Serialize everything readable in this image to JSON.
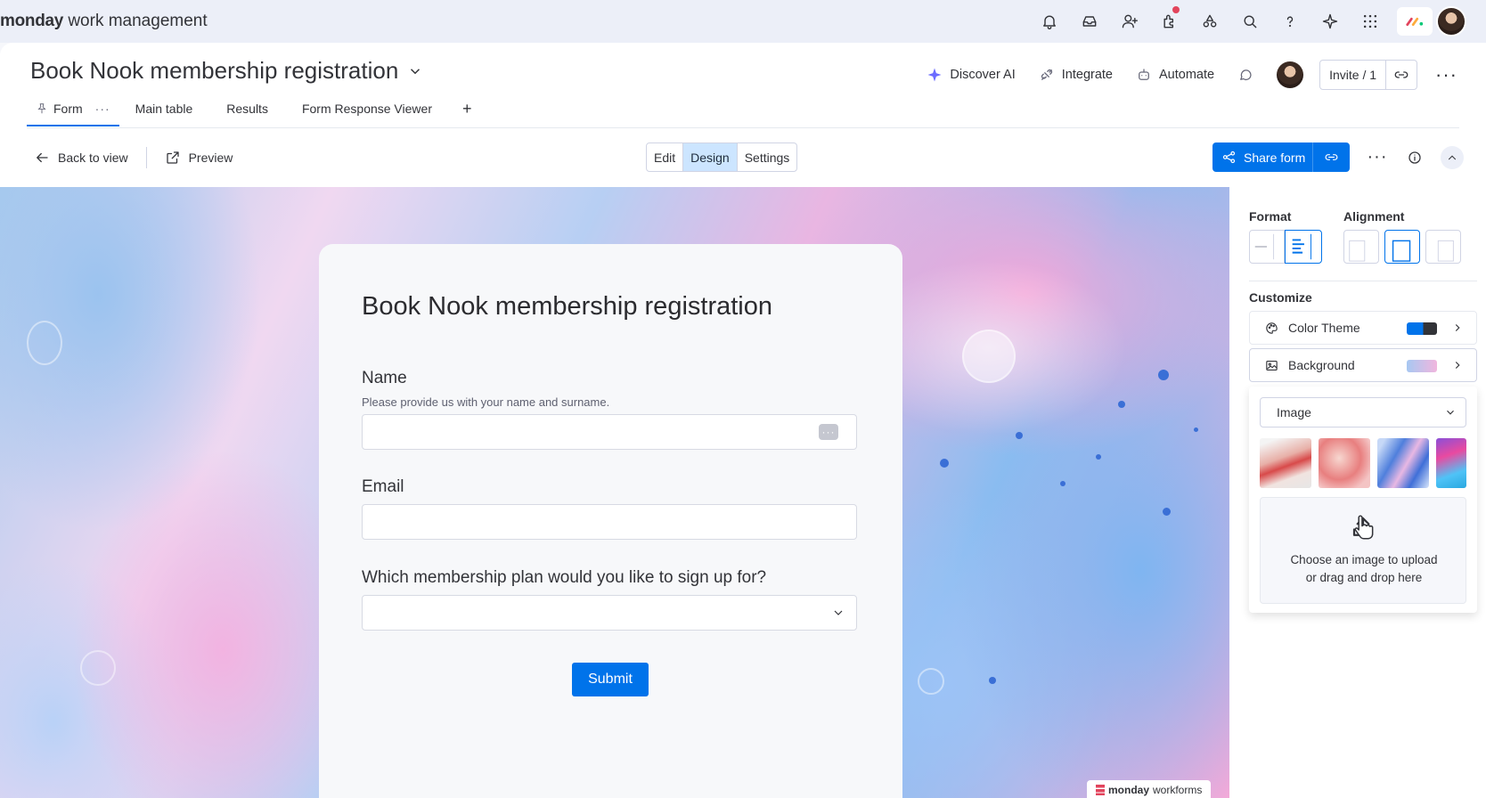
{
  "app": {
    "brand_bold": "monday",
    "brand_rest": " work management"
  },
  "board": {
    "title": "Book Nook membership registration",
    "actions": {
      "discover_ai": "Discover AI",
      "integrate": "Integrate",
      "automate": "Automate",
      "invite": "Invite / 1"
    },
    "tabs": [
      {
        "label": "Form",
        "more": "···"
      },
      {
        "label": "Main table"
      },
      {
        "label": "Results"
      },
      {
        "label": "Form Response Viewer"
      }
    ],
    "add_tab": "+"
  },
  "toolbar": {
    "back": "Back to view",
    "preview": "Preview",
    "modes": [
      "Edit",
      "Design",
      "Settings"
    ],
    "active_mode": "Design",
    "share": "Share form"
  },
  "form": {
    "title": "Book Nook membership registration",
    "fields": [
      {
        "label": "Name",
        "description": "Please provide us with your name and surname.",
        "value": ""
      },
      {
        "label": "Email",
        "value": ""
      },
      {
        "label": "Which membership plan would you like to sign up for?",
        "value": ""
      }
    ],
    "submit": "Submit",
    "badge_bold": "monday",
    "badge_rest": " workforms"
  },
  "panel": {
    "format_label": "Format",
    "alignment_label": "Alignment",
    "customize_label": "Customize",
    "color_theme": "Color Theme",
    "background": "Background",
    "background_type": "Image",
    "upload_line1": "Choose an image to upload",
    "upload_line2": "or drag and drop here"
  },
  "colors": {
    "accent": "#0073ea",
    "selected_bg": "#cce5ff",
    "notification": "#e2445c"
  }
}
